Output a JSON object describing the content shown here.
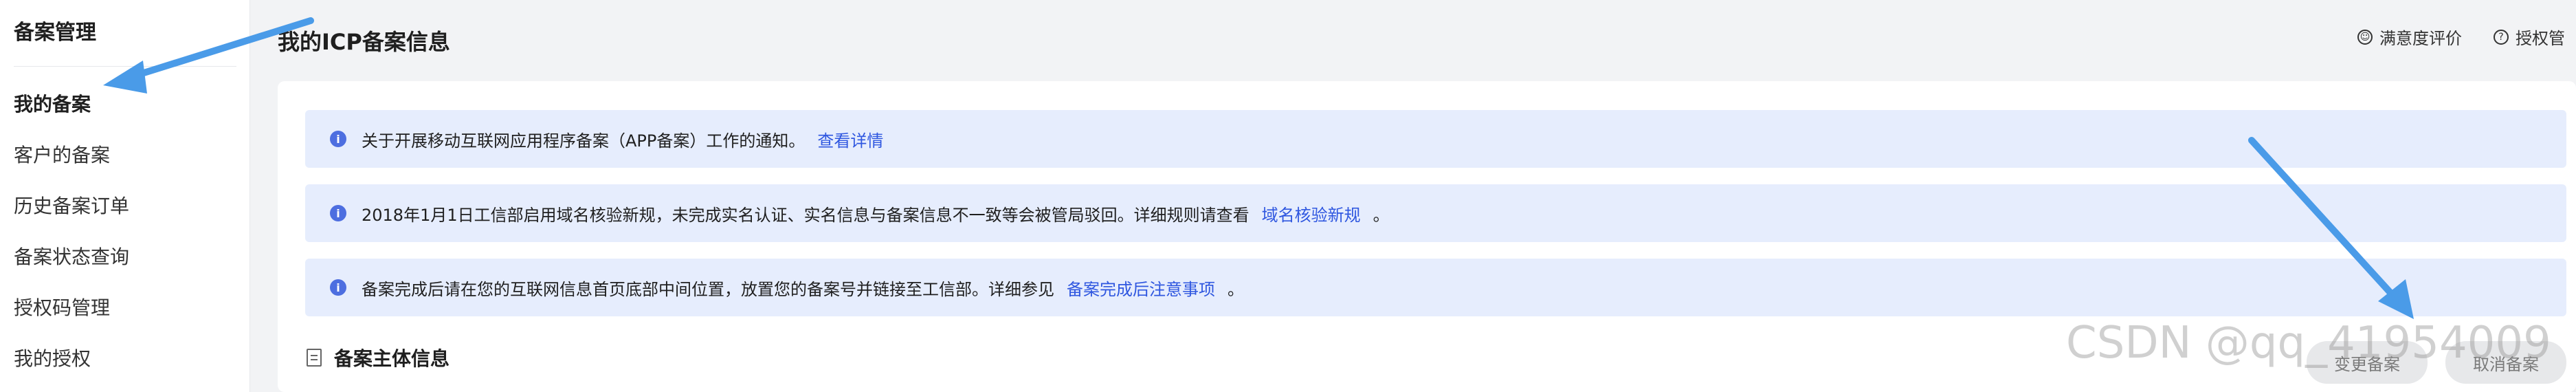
{
  "sidebar": {
    "title": "备案管理",
    "items": [
      {
        "label": "我的备案",
        "active": true
      },
      {
        "label": "客户的备案",
        "active": false
      },
      {
        "label": "历史备案订单",
        "active": false
      },
      {
        "label": "备案状态查询",
        "active": false
      },
      {
        "label": "授权码管理",
        "active": false
      },
      {
        "label": "我的授权",
        "active": false
      }
    ]
  },
  "header": {
    "title": "我的ICP备案信息",
    "actions": [
      {
        "label": "满意度评价",
        "icon": "smiley-icon"
      },
      {
        "label": "授权管",
        "icon": "help-icon"
      }
    ]
  },
  "notices": [
    {
      "text": "关于开展移动互联网应用程序备案（APP备案）工作的通知。",
      "link": "查看详情",
      "tail": ""
    },
    {
      "text": "2018年1月1日工信部启用域名核验新规，未完成实名认证、实名信息与备案信息不一致等会被管局驳回。详细规则请查看",
      "link": "域名核验新规",
      "tail": "。"
    },
    {
      "text": "备案完成后请在您的互联网信息首页底部中间位置，放置您的备案号并链接至工信部。详细参见",
      "link": "备案完成后注意事项",
      "tail": "。"
    }
  ],
  "section": {
    "title": "备案主体信息"
  },
  "buttons": {
    "change": "变更备案",
    "cancel": "取消备案"
  },
  "watermark": "CSDN @qq_41954009",
  "colors": {
    "accent": "#2f57e0",
    "notice_bg": "#e6edfd",
    "arrow": "#4a9be8"
  }
}
